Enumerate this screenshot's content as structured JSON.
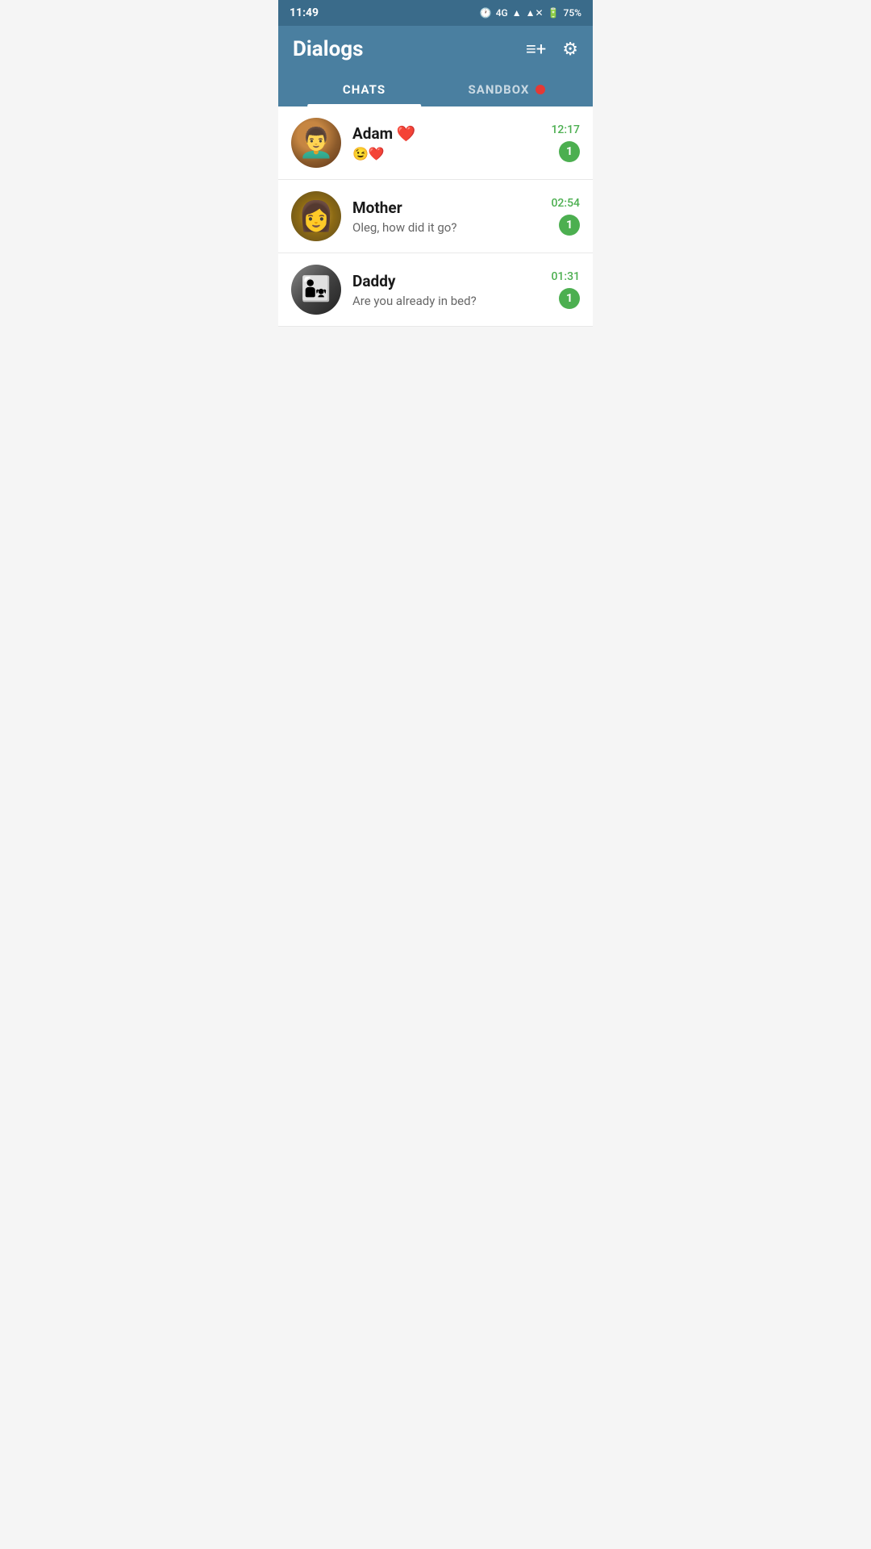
{
  "statusBar": {
    "time": "11:49",
    "battery": "75%",
    "network": "4G"
  },
  "header": {
    "title": "Dialogs",
    "newChatIcon": "≡+",
    "settingsIcon": "⚙"
  },
  "tabs": [
    {
      "label": "CHATS",
      "active": true
    },
    {
      "label": "SANDBOX",
      "active": false
    }
  ],
  "chats": [
    {
      "id": "adam",
      "name": "Adam ❤️",
      "preview": "😉❤️",
      "time": "12:17",
      "unread": "1",
      "hasEmoji": true
    },
    {
      "id": "mother",
      "name": "Mother",
      "preview": "Oleg, how did it go?",
      "time": "02:54",
      "unread": "1",
      "hasEmoji": false
    },
    {
      "id": "daddy",
      "name": "Daddy",
      "preview": "Are you already in bed?",
      "time": "01:31",
      "unread": "1",
      "hasEmoji": false
    }
  ]
}
